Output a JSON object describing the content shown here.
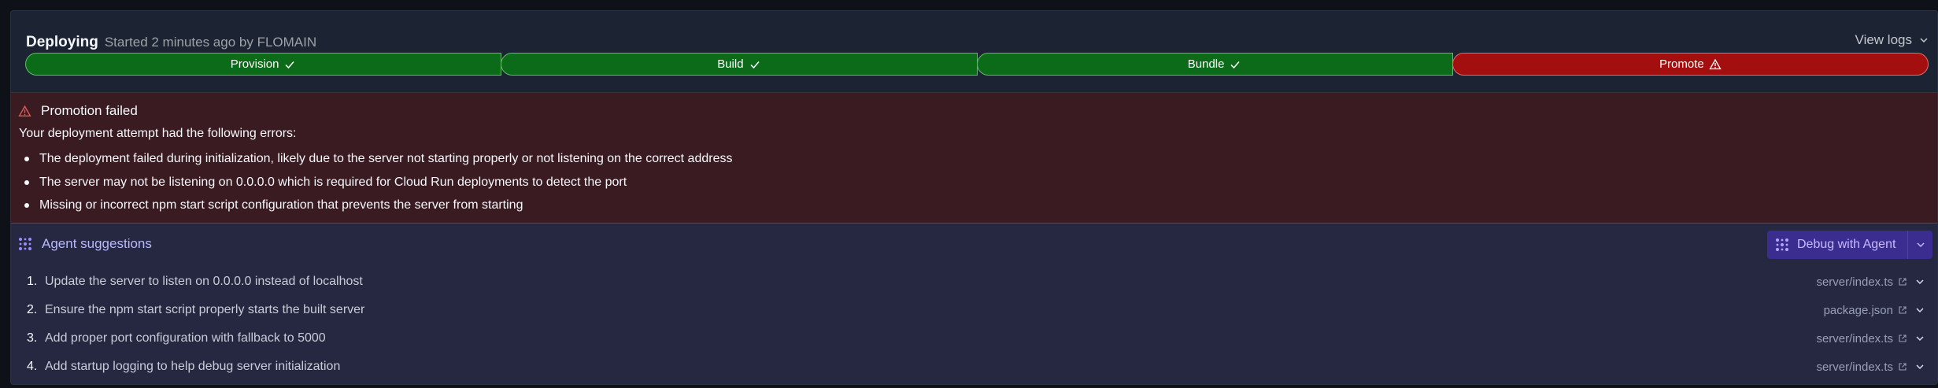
{
  "header": {
    "title": "Deploying",
    "subtitle": "Started 2 minutes ago by FLOMAIN",
    "view_logs": "View logs"
  },
  "stages": [
    {
      "label": "Provision",
      "status": "success"
    },
    {
      "label": "Build",
      "status": "success"
    },
    {
      "label": "Bundle",
      "status": "success"
    },
    {
      "label": "Promote",
      "status": "failed"
    }
  ],
  "error": {
    "title": "Promotion failed",
    "intro": "Your deployment attempt had the following errors:",
    "items": [
      "The deployment failed during initialization, likely due to the server not starting properly or not listening on the correct address",
      "The server may not be listening on 0.0.0.0 which is required for Cloud Run deployments to detect the port",
      "Missing or incorrect npm start script configuration that prevents the server from starting"
    ]
  },
  "suggestions": {
    "title": "Agent suggestions",
    "debug_button": "Debug with Agent",
    "steps": [
      {
        "num": "1.",
        "text": "Update the server to listen on 0.0.0.0 instead of localhost",
        "file": "server/index.ts"
      },
      {
        "num": "2.",
        "text": "Ensure the npm start script properly starts the built server",
        "file": "package.json"
      },
      {
        "num": "3.",
        "text": "Add proper port configuration with fallback to 5000",
        "file": "server/index.ts"
      },
      {
        "num": "4.",
        "text": "Add startup logging to help debug server initialization",
        "file": "server/index.ts"
      }
    ]
  },
  "colors": {
    "success": "#0b6b18",
    "failed": "#a30f0f",
    "error_bg": "#3a1b22",
    "suggest_bg": "#262741",
    "accent": "#3b2d8f"
  }
}
